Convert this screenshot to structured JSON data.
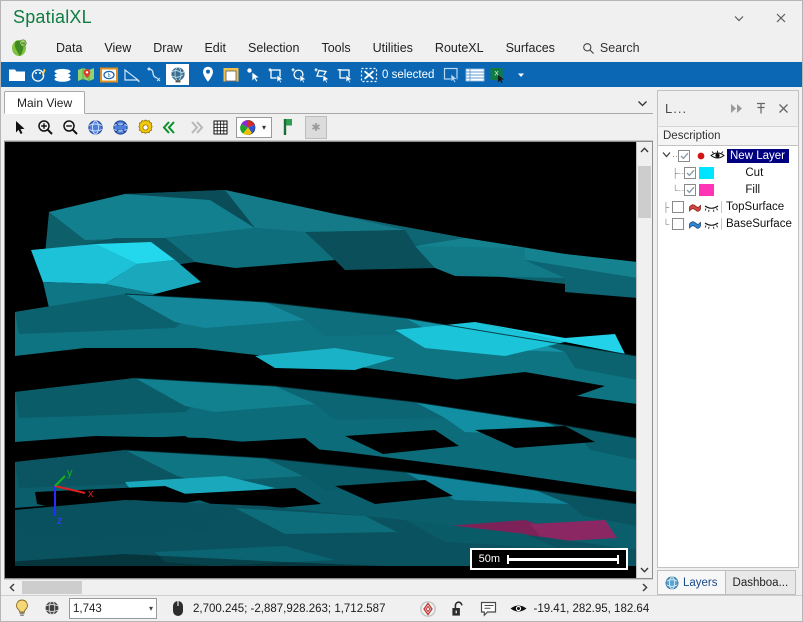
{
  "window": {
    "title": "SpatialXL",
    "minimize_label": "▾",
    "close_label": "✕"
  },
  "menu": {
    "logo_icon": "africa-globe-logo-icon",
    "items": [
      {
        "label": "Data"
      },
      {
        "label": "View"
      },
      {
        "label": "Draw"
      },
      {
        "label": "Edit"
      },
      {
        "label": "Selection"
      },
      {
        "label": "Tools"
      },
      {
        "label": "Utilities"
      },
      {
        "label": "RouteXL"
      },
      {
        "label": "Surfaces"
      }
    ],
    "search_label": "Search",
    "search_icon": "search-icon"
  },
  "ribbon": {
    "selection_status": "0 selected",
    "icons": [
      {
        "name": "open-folder-icon"
      },
      {
        "name": "palette-brush-icon"
      },
      {
        "name": "layers-stack-icon"
      },
      {
        "name": "map-pin-icon"
      },
      {
        "name": "boundary-box-icon"
      },
      {
        "name": "measure-angle-icon"
      },
      {
        "name": "polyline-edit-icon"
      },
      {
        "name": "globe-icon"
      },
      {
        "name": "location-pin-icon"
      },
      {
        "name": "page-note-icon"
      },
      {
        "name": "select-point-icon"
      },
      {
        "name": "select-box-add-icon"
      },
      {
        "name": "select-circle-add-icon"
      },
      {
        "name": "select-lasso-add-icon"
      },
      {
        "name": "select-box-remove-icon"
      },
      {
        "name": "clear-selection-icon"
      },
      {
        "name": "select-window-icon"
      },
      {
        "name": "table-view-icon"
      },
      {
        "name": "export-excel-icon"
      },
      {
        "name": "overflow-caret-icon"
      }
    ]
  },
  "tabs": {
    "items": [
      {
        "label": "Main View"
      }
    ],
    "overflow_icon": "chevron-down-icon"
  },
  "viewbar": {
    "icons": [
      {
        "name": "pointer-arrow-icon"
      },
      {
        "name": "zoom-in-icon"
      },
      {
        "name": "zoom-out-icon"
      },
      {
        "name": "globe-zoom-extents-icon"
      },
      {
        "name": "globe-zoom-selection-icon"
      },
      {
        "name": "view-settings-gear-icon"
      },
      {
        "name": "step-back-icon"
      },
      {
        "name": "step-forward-icon"
      },
      {
        "name": "grid-icon"
      }
    ],
    "palette_icon": "color-palette-icon",
    "palette_caret": "▾",
    "bookmark_icon": "green-flag-bookmark-icon",
    "placeholder_icon": "star-placeholder-icon"
  },
  "canvas": {
    "scalebar_label": "50m",
    "axis_labels": {
      "x": "x",
      "y": "y",
      "z": "z"
    },
    "background_color": "#000000",
    "surface_color": "#14808c",
    "surface_highlight_color": "#1fd3e8",
    "surface_fill_color": "#7d2259",
    "vscroll_up_icon": "chevron-up-icon",
    "vscroll_down_icon": "chevron-down-icon",
    "hscroll_left_icon": "chevron-left-icon",
    "hscroll_right_icon": "chevron-right-icon"
  },
  "panel": {
    "title": "L...",
    "forward_icon": "forward-arrows-icon",
    "pin_icon": "pin-icon",
    "close_icon": "close-icon",
    "column_header": "Description",
    "tree": [
      {
        "label": "New Layer",
        "level": 0,
        "selected": true,
        "expander": "expanded",
        "checked": true,
        "marker_icon": "red-dot-icon",
        "visibility_icon": "eye-open-icon"
      },
      {
        "label": "Cut",
        "level": 1,
        "selected": false,
        "checked": true,
        "swatch_color": "#00e5ff"
      },
      {
        "label": "Fill",
        "level": 1,
        "selected": false,
        "checked": true,
        "swatch_color": "#ff33b5"
      },
      {
        "label": "TopSurface",
        "level": 0,
        "selected": false,
        "checked": false,
        "surface_icon": "red-surface-icon",
        "visibility_icon": "eye-closed-icon"
      },
      {
        "label": "BaseSurface",
        "level": 0,
        "selected": false,
        "checked": false,
        "surface_icon": "blue-surface-icon",
        "visibility_icon": "eye-closed-icon"
      }
    ],
    "bottom_tabs": [
      {
        "label": "Layers",
        "icon": "globe-icon",
        "active": true
      },
      {
        "label": "Dashboa...",
        "icon": "",
        "active": false
      }
    ]
  },
  "statusbar": {
    "lightbulb_icon": "lightbulb-icon",
    "globe_icon": "globe-dark-icon",
    "scale_value": "1,743",
    "scale_caret": "▾",
    "mouse_icon": "mouse-icon",
    "coordinates": "2,700.245; -2,887,928.263; 1,712.587",
    "target_icon": "target-crosshair-icon",
    "lock_icon": "unlocked-padlock-icon",
    "note_icon": "comment-note-icon",
    "eye_icon": "eye-icon",
    "view_values": "-19.41, 282.95, 182.64"
  }
}
